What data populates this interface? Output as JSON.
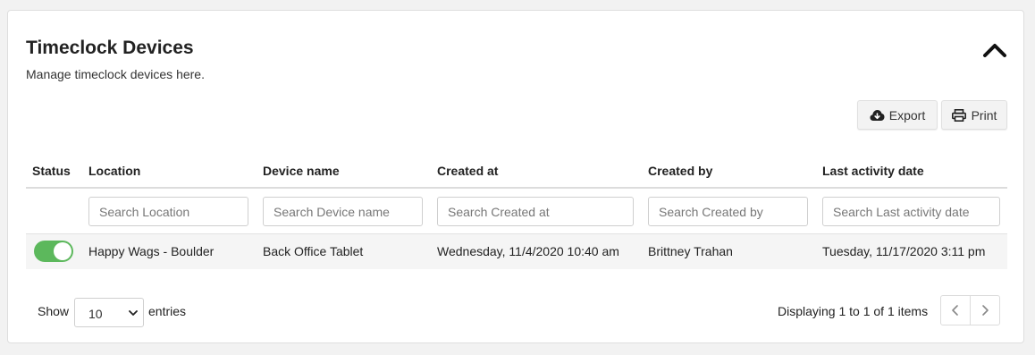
{
  "panel": {
    "title": "Timeclock Devices",
    "subtitle": "Manage timeclock devices here."
  },
  "toolbar": {
    "export_label": "Export",
    "print_label": "Print"
  },
  "table": {
    "columns": [
      "Status",
      "Location",
      "Device name",
      "Created at",
      "Created by",
      "Last activity date"
    ],
    "filters": [
      {
        "placeholder": "Search Location"
      },
      {
        "placeholder": "Search Device name"
      },
      {
        "placeholder": "Search Created at"
      },
      {
        "placeholder": "Search Created by"
      },
      {
        "placeholder": "Search Last activity date"
      }
    ],
    "rows": [
      {
        "status_enabled": true,
        "location": "Happy Wags - Boulder",
        "device_name": "Back Office Tablet",
        "created_at": "Wednesday, 11/4/2020 10:40 am",
        "created_by": "Brittney Trahan",
        "last_activity": "Tuesday, 11/17/2020 3:11 pm"
      }
    ]
  },
  "footer": {
    "show_label": "Show",
    "entries_value": "10",
    "entries_label": "entries",
    "pagination_text": "Displaying 1 to 1 of 1 items"
  },
  "colors": {
    "toggle_on": "#5cb85c",
    "row_bg": "#f5f5f5"
  },
  "icons": {
    "collapse": "chevron-up-icon",
    "export": "cloud-download-icon",
    "print": "printer-icon",
    "prev": "chevron-left-icon",
    "next": "chevron-right-icon"
  }
}
